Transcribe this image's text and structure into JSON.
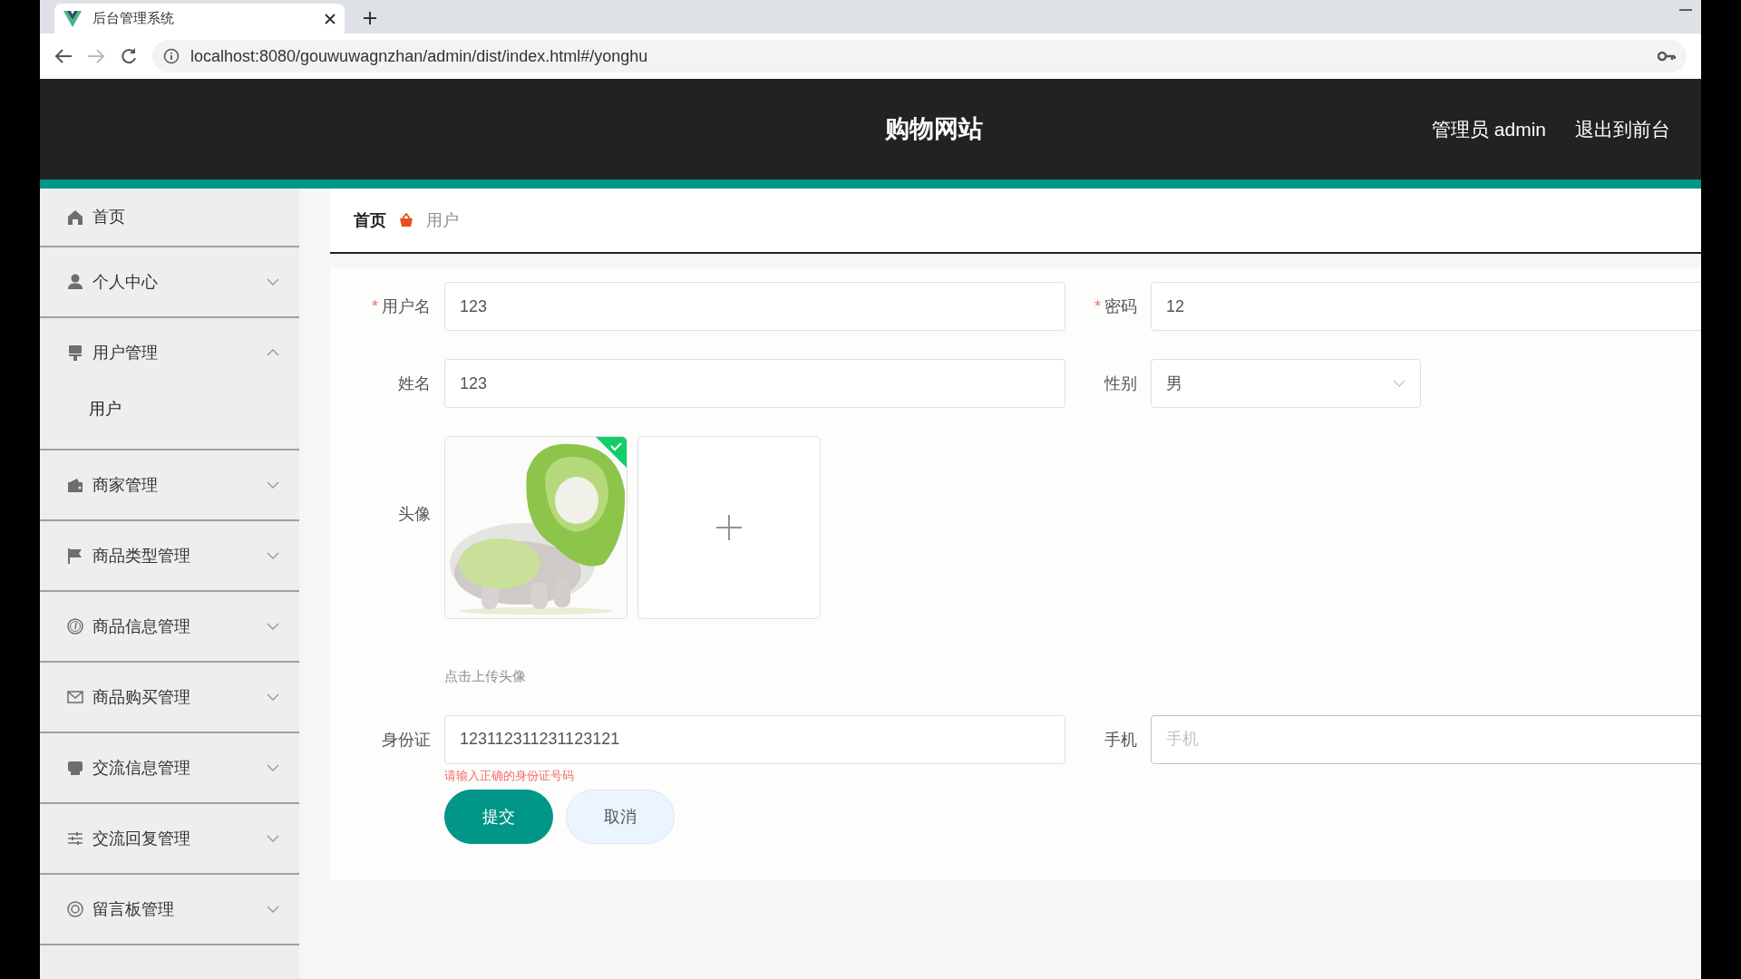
{
  "browser": {
    "tab_title": "后台管理系统",
    "url": "localhost:8080/gouwuwagnzhan/admin/dist/index.html#/yonghu",
    "forward_disabled": true
  },
  "header": {
    "title": "购物网站",
    "links": [
      "管理员 admin",
      "退出到前台"
    ]
  },
  "sidebar": {
    "items": [
      {
        "kind": "link",
        "label": "首页"
      },
      {
        "kind": "menu",
        "label": "个人中心",
        "expanded": false
      },
      {
        "kind": "menu",
        "label": "用户管理",
        "expanded": true,
        "children": [
          {
            "label": "用户",
            "selected": true
          }
        ]
      },
      {
        "kind": "menu",
        "label": "商家管理",
        "expanded": false
      },
      {
        "kind": "menu",
        "label": "商品类型管理",
        "expanded": false
      },
      {
        "kind": "menu",
        "label": "商品信息管理",
        "expanded": false
      },
      {
        "kind": "menu",
        "label": "商品购买管理",
        "expanded": false
      },
      {
        "kind": "menu",
        "label": "交流信息管理",
        "expanded": false
      },
      {
        "kind": "menu",
        "label": "交流回复管理",
        "expanded": false
      },
      {
        "kind": "menu",
        "label": "留言板管理",
        "expanded": false
      }
    ]
  },
  "breadcrumb": [
    "首页",
    "用户"
  ],
  "form": {
    "fields": [
      {
        "kind": "input",
        "label": "用户名",
        "required_mark": "*",
        "value": "123"
      },
      {
        "kind": "input",
        "label": "密码",
        "required_mark": "*",
        "value": "12"
      },
      {
        "kind": "input",
        "label": "姓名",
        "value": "123"
      },
      {
        "kind": "select",
        "label": "性别",
        "value": "男"
      },
      {
        "kind": "upload",
        "label": "头像",
        "uploaded": true,
        "hint": "点击上传头像"
      },
      {
        "kind": "input",
        "label": "身份证",
        "value": "123112311231123121",
        "error": "请输入正确的身份证号码"
      },
      {
        "kind": "input",
        "label": "手机",
        "placeholder": "手机",
        "focused": true
      }
    ],
    "buttons": [
      {
        "kind": "primary",
        "label": "提交"
      },
      {
        "kind": "cancel",
        "label": "取消"
      }
    ]
  }
}
